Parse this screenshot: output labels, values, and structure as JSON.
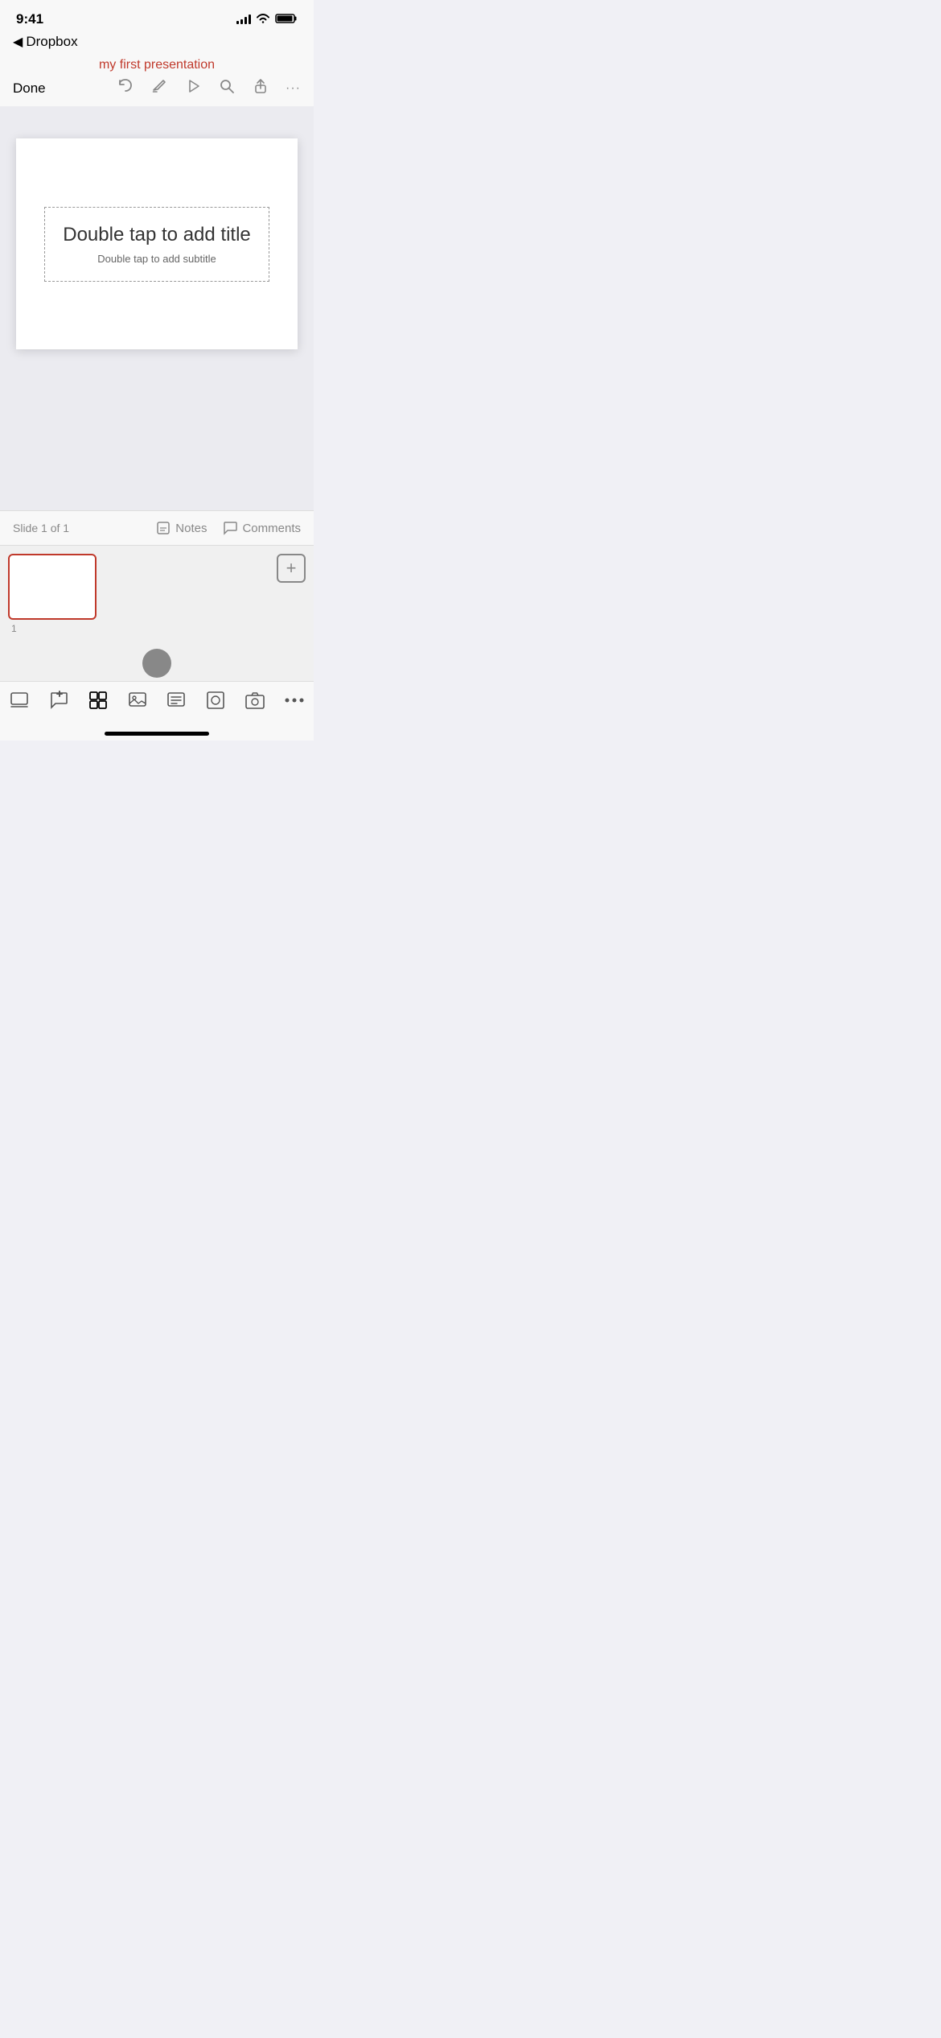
{
  "statusBar": {
    "time": "9:41",
    "backLabel": "Dropbox"
  },
  "titleBar": {
    "presentationTitle": "my first presentation",
    "doneLabel": "Done"
  },
  "toolbar": {
    "undoIcon": "↩",
    "annotateIcon": "✏",
    "playIcon": "▷",
    "searchIcon": "⌕",
    "shareIcon": "↑",
    "moreIcon": "···"
  },
  "slide": {
    "titlePlaceholder": "Double tap to add title",
    "subtitlePlaceholder": "Double tap to add subtitle"
  },
  "bottomBar": {
    "slideCounter": "Slide 1 of 1",
    "notesLabel": "Notes",
    "commentsLabel": "Comments"
  },
  "thumbnail": {
    "slideNumber": "1"
  },
  "bottomToolbar": {
    "items": [
      {
        "icon": "⊟",
        "name": "slides-icon"
      },
      {
        "icon": "💬",
        "name": "comment-add-icon"
      },
      {
        "icon": "⊞",
        "name": "grid-icon"
      },
      {
        "icon": "🖼",
        "name": "image-icon"
      },
      {
        "icon": "☰",
        "name": "list-icon"
      },
      {
        "icon": "⊡",
        "name": "shapes-icon"
      },
      {
        "icon": "📷",
        "name": "camera-icon"
      },
      {
        "icon": "•••",
        "name": "more-tools-icon"
      }
    ]
  }
}
